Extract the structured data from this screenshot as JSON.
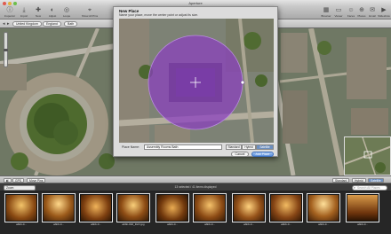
{
  "window": {
    "title": "Aperture"
  },
  "toolbar": {
    "buttons": [
      {
        "label": "Inspector",
        "icon": "info-icon"
      },
      {
        "label": "Import",
        "icon": "import-icon"
      },
      {
        "label": "New",
        "icon": "new-icon"
      },
      {
        "label": "Adjust",
        "icon": "adjust-icon"
      },
      {
        "label": "Loupe",
        "icon": "loupe-icon"
      },
      {
        "label": "Show All Pins",
        "icon": "pins-icon"
      }
    ],
    "right_buttons": [
      {
        "label": "Browser",
        "icon": "grid-icon"
      },
      {
        "label": "Viewer",
        "icon": "viewer-icon"
      },
      {
        "label": "Faces",
        "icon": "faces-icon"
      },
      {
        "label": "Places",
        "icon": "places-icon"
      },
      {
        "label": "Email",
        "icon": "email-icon"
      },
      {
        "label": "Slideshow",
        "icon": "slideshow-icon"
      }
    ]
  },
  "location": {
    "crumbs": [
      "United Kingdom",
      "England",
      "Bath"
    ]
  },
  "dialog": {
    "title": "New Place",
    "subtitle": "Name your place, move the center point or adjust its size.",
    "name_label": "Place Name:",
    "name_value": "Assembly Rooms Bath",
    "map_modes": [
      "Standard",
      "Hybrid",
      "Satellite"
    ],
    "selected_mode": "Satellite",
    "cancel_label": "Cancel",
    "add_label": "Add Place"
  },
  "midbar": {
    "left": [
      "GPS",
      "Move Pins"
    ],
    "map_modes": [
      "Standard",
      "Hybrid",
      "Satellite"
    ],
    "selected_mode": "Satellite"
  },
  "filterbar": {
    "filter_value": "Zoom",
    "status": "13 selected / 41 items displayed",
    "search_placeholder": "Search All Places"
  },
  "thumbnails": [
    {
      "caption": "abbb-0..."
    },
    {
      "caption": "abbb-0..."
    },
    {
      "caption": "abbb-0..."
    },
    {
      "caption": "abbb-002_DxO.jpg"
    },
    {
      "caption": "abbb-0..."
    },
    {
      "caption": "abbb-0..."
    },
    {
      "caption": "abbb-0..."
    },
    {
      "caption": "abbb-0..."
    },
    {
      "caption": "abbb-0..."
    },
    {
      "caption": "abbb-0..."
    }
  ],
  "colors": {
    "place_circle": "#8a3fc1",
    "selected_segment": "#6d8fbf",
    "thumb_warm": "#a35a17"
  }
}
